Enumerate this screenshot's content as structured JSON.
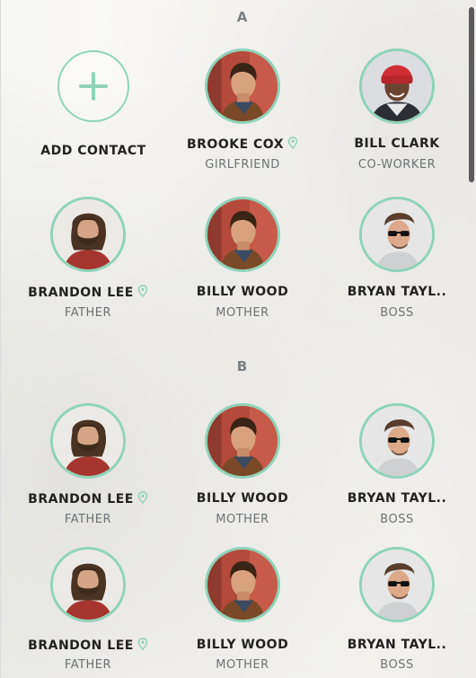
{
  "sections": [
    {
      "letter": "A"
    },
    {
      "letter": "B"
    }
  ],
  "add_contact": {
    "label": "ADD CONTACT"
  },
  "contacts_a": [
    {
      "name": "BROOKE COX",
      "role": "GIRLFRIEND",
      "location": true,
      "avatar": "man-brown-hair"
    },
    {
      "name": "BILL CLARK",
      "role": "CO-WORKER",
      "location": false,
      "avatar": "man-red-beanie"
    },
    {
      "name": "BRANDON LEE",
      "role": "FATHER",
      "location": true,
      "avatar": "man-long-hair-beard"
    },
    {
      "name": "BILLY WOOD",
      "role": "MOTHER",
      "location": false,
      "avatar": "man-brown-hair"
    },
    {
      "name": "BRYAN TAYL..",
      "role": "BOSS",
      "location": false,
      "avatar": "man-sunglasses"
    }
  ],
  "contacts_b": [
    {
      "name": "BRANDON LEE",
      "role": "FATHER",
      "location": true,
      "avatar": "man-long-hair-beard"
    },
    {
      "name": "BILLY WOOD",
      "role": "MOTHER",
      "location": false,
      "avatar": "man-brown-hair"
    },
    {
      "name": "BRYAN TAYL..",
      "role": "BOSS",
      "location": false,
      "avatar": "man-sunglasses"
    },
    {
      "name": "BRANDON LEE",
      "role": "FATHER",
      "location": true,
      "avatar": "man-long-hair-beard"
    },
    {
      "name": "BILLY WOOD",
      "role": "MOTHER",
      "location": false,
      "avatar": "man-brown-hair"
    },
    {
      "name": "BRYAN TAYL..",
      "role": "BOSS",
      "location": false,
      "avatar": "man-sunglasses"
    }
  ],
  "colors": {
    "accent": "#8ed3b9",
    "name_text": "#222222",
    "role_text": "#6d7275",
    "section_letter": "#7b8083"
  }
}
